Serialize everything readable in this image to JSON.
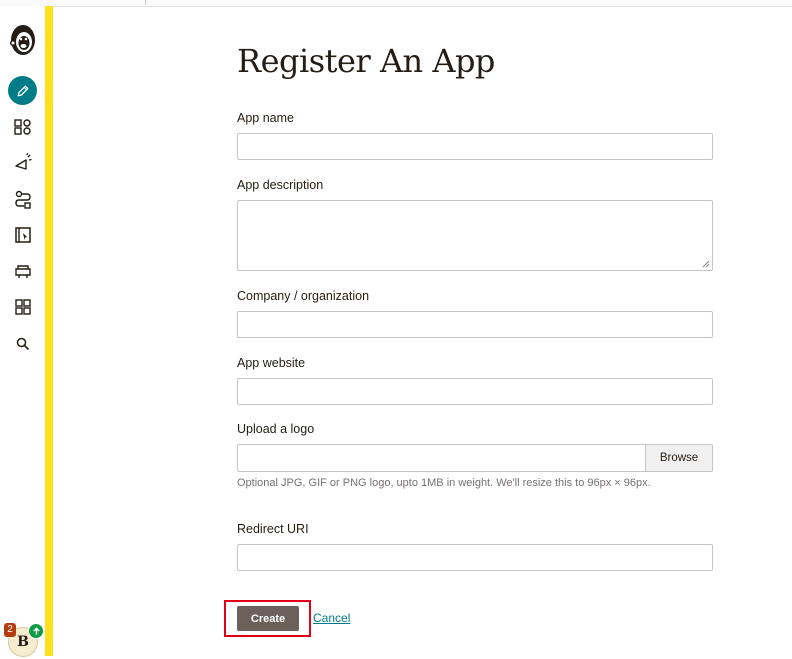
{
  "page": {
    "title": "Register An App"
  },
  "form": {
    "app_name_label": "App name",
    "app_name_value": "",
    "app_description_label": "App description",
    "app_description_value": "",
    "company_label": "Company / organization",
    "company_value": "",
    "app_website_label": "App website",
    "app_website_value": "",
    "logo_label": "Upload a logo",
    "browse_label": "Browse",
    "logo_hint": "Optional JPG, GIF or PNG logo, upto 1MB in weight. We'll resize this to 96px × 96px.",
    "redirect_label": "Redirect URI",
    "redirect_value": "",
    "create_label": "Create",
    "cancel_label": "Cancel"
  },
  "sidebar": {
    "items": [
      {
        "name": "create",
        "icon": "pencil-icon"
      },
      {
        "name": "audience",
        "icon": "audience-icon"
      },
      {
        "name": "campaigns",
        "icon": "megaphone-icon"
      },
      {
        "name": "automations",
        "icon": "automation-icon"
      },
      {
        "name": "website",
        "icon": "website-icon"
      },
      {
        "name": "content",
        "icon": "content-icon"
      },
      {
        "name": "integrations",
        "icon": "grid-icon"
      },
      {
        "name": "search",
        "icon": "search-icon"
      }
    ],
    "account": {
      "initial": "B",
      "notification_count": "2"
    }
  },
  "colors": {
    "accent_teal": "#007c89",
    "brand_yellow": "#ffe01b",
    "button_dark": "#6b605a",
    "highlight_red": "#e0001a"
  }
}
